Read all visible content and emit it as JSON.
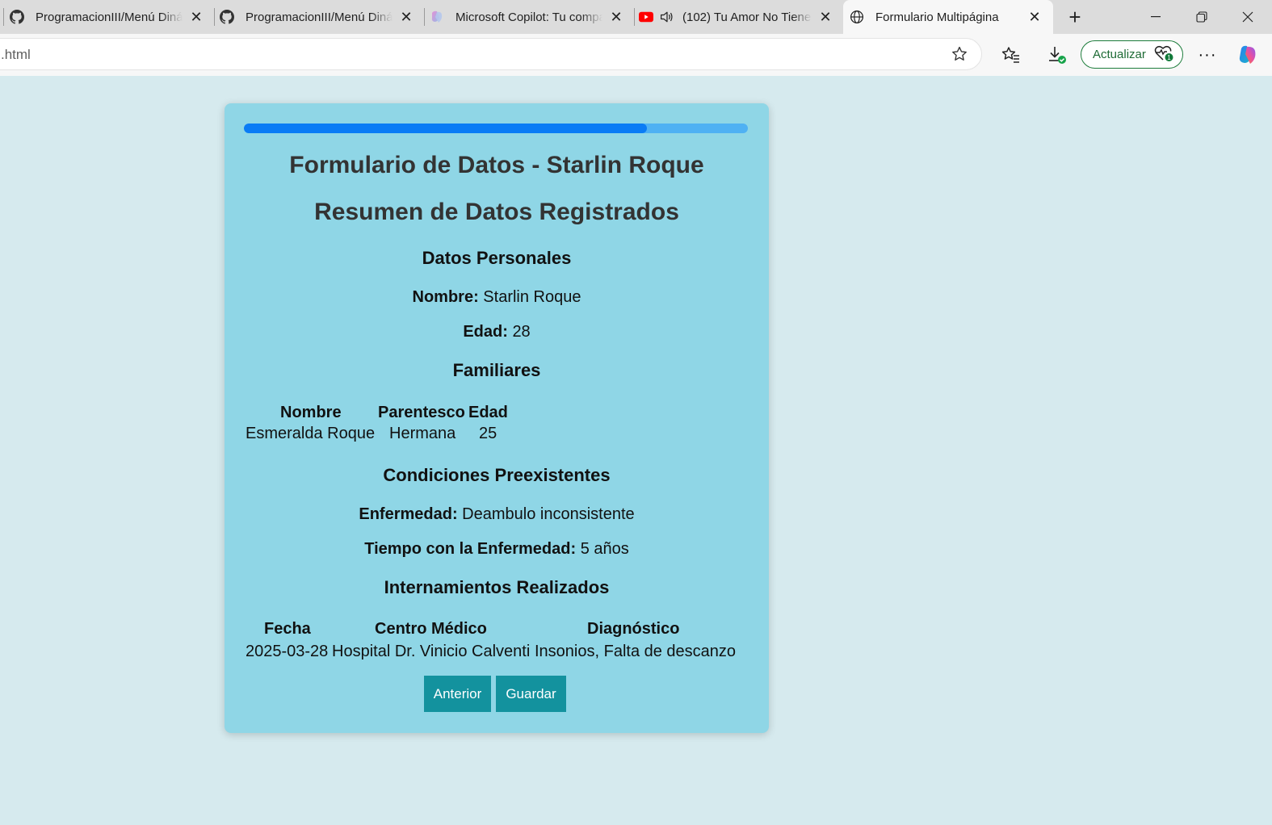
{
  "browser": {
    "tabs": [
      {
        "title": "ProgramacionIII/Menú Dinám",
        "icon": "github-icon",
        "active": false
      },
      {
        "title": "ProgramacionIII/Menú Dinám",
        "icon": "github-icon",
        "active": false
      },
      {
        "title": "Microsoft Copilot: Tu compa",
        "icon": "copilot-icon",
        "active": false
      },
      {
        "title": "(102) Tu Amor No Tiene",
        "icon": "youtube-icon",
        "active": false
      },
      {
        "title": "Formulario Multipágina",
        "icon": "globe-icon",
        "active": true
      }
    ],
    "url": ".html",
    "update_label": "Actualizar"
  },
  "form": {
    "progress": 0.8,
    "title": "Formulario de Datos - Starlin Roque",
    "summary_title": "Resumen de Datos Registrados",
    "personal": {
      "heading": "Datos Personales",
      "name_label": "Nombre:",
      "name_value": "Starlin Roque",
      "age_label": "Edad:",
      "age_value": "28"
    },
    "family": {
      "heading": "Familiares",
      "headers": [
        "Nombre",
        "Parentesco",
        "Edad"
      ],
      "rows": [
        [
          "Esmeralda Roque",
          "Hermana",
          "25"
        ]
      ]
    },
    "conditions": {
      "heading": "Condiciones Preexistentes",
      "disease_label": "Enfermedad:",
      "disease_value": "Deambulo inconsistente",
      "time_label": "Tiempo con la Enfermedad:",
      "time_value": "5 años"
    },
    "hospitalizations": {
      "heading": "Internamientos Realizados",
      "headers": [
        "Fecha",
        "Centro Médico",
        "Diagnóstico"
      ],
      "rows": [
        [
          "2025-03-28",
          "Hospital Dr. Vinicio Calventi",
          "Insonios, Falta de descanzo"
        ]
      ]
    },
    "buttons": {
      "previous": "Anterior",
      "save": "Guardar"
    }
  }
}
